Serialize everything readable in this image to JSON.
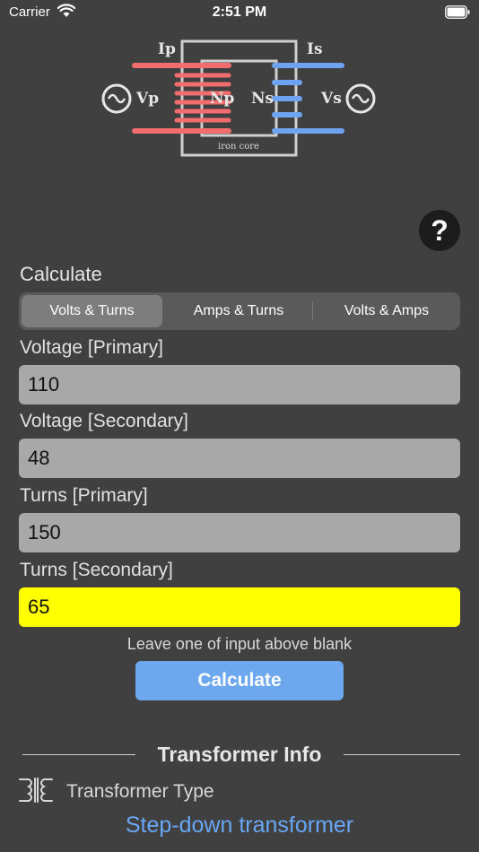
{
  "status_bar": {
    "carrier": "Carrier",
    "time": "2:51 PM"
  },
  "diagram": {
    "label_ip": "Ip",
    "label_is": "Is",
    "label_vp": "Vp",
    "label_vs": "Vs",
    "label_np": "Np",
    "label_ns": "Ns",
    "label_core": "iron core",
    "primary_color": "#f26d6d",
    "secondary_color": "#6ea3f2"
  },
  "help": {
    "label": "?"
  },
  "calculate_section": {
    "title": "Calculate",
    "tabs": [
      {
        "label": "Volts & Turns",
        "selected": true
      },
      {
        "label": "Amps & Turns",
        "selected": false
      },
      {
        "label": "Volts & Amps",
        "selected": false
      }
    ]
  },
  "fields": {
    "voltage_primary": {
      "label": "Voltage [Primary]",
      "value": "110"
    },
    "voltage_secondary": {
      "label": "Voltage [Secondary]",
      "value": "48"
    },
    "turns_primary": {
      "label": "Turns [Primary]",
      "value": "150"
    },
    "turns_secondary": {
      "label": "Turns [Secondary]",
      "value": "65",
      "highlight_color": "#ffff00"
    }
  },
  "hint": "Leave one of input above blank",
  "calculate_button": "Calculate",
  "transformer_info": {
    "title": "Transformer Info",
    "type_label": "Transformer Type",
    "icon": "transformer-icon",
    "type_value": "Step-down transformer",
    "type_value_color": "#68a7f5"
  }
}
